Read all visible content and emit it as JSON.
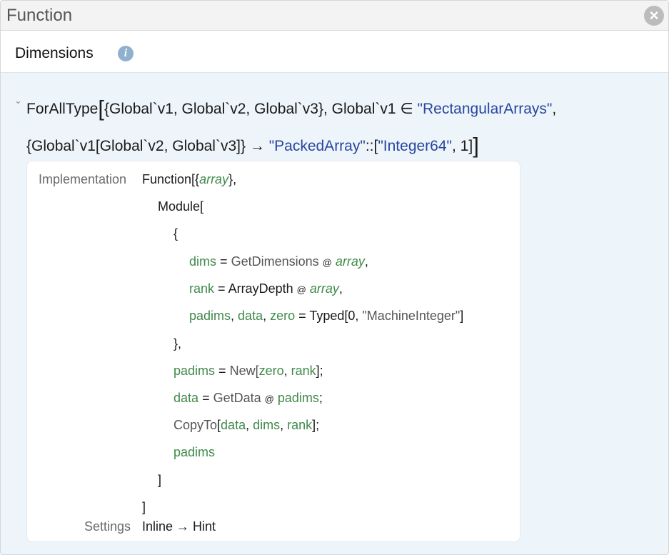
{
  "window": {
    "title": "Function",
    "close_icon": "close-circle-icon"
  },
  "dimensions": {
    "label": "Dimensions",
    "info_icon": "info-icon"
  },
  "signature": {
    "collapse_icon": "chevron-down-icon",
    "head": "ForAllType",
    "vars": "{Global`v1, Global`v2, Global`v3}",
    "constraint_var": "Global`v1",
    "element_of": "∈",
    "constraint_type": "\"RectangularArrays\"",
    "arg_type": "{Global`v1[Global`v2, Global`v3]}",
    "arrow": "→",
    "return_type": "\"PackedArray\"",
    "sep": "::",
    "elem_type": "\"Integer64\"",
    "rank": "1"
  },
  "implementation": {
    "label": "Implementation",
    "function_head": "Function[{",
    "array_arg": "array",
    "function_tail": "},",
    "module": "Module[",
    "open_brace": "{",
    "dims": "dims",
    "eq": "=",
    "get_dimensions": "GetDimensions",
    "at": "@",
    "array": "array",
    "rank": "rank",
    "array_depth": "ArrayDepth",
    "padims": "padims",
    "data": "data",
    "zero": "zero",
    "typed": "Typed[",
    "typed_zero": "0",
    "machine_integer": "\"MachineInteger\"",
    "close_brace": "},",
    "new": "New[",
    "get_data": "GetData",
    "copy_to": "CopyTo",
    "padims_last": "padims",
    "module_close": "]",
    "function_close": "]"
  },
  "settings": {
    "label": "Settings",
    "value": "Inline → Hint"
  }
}
